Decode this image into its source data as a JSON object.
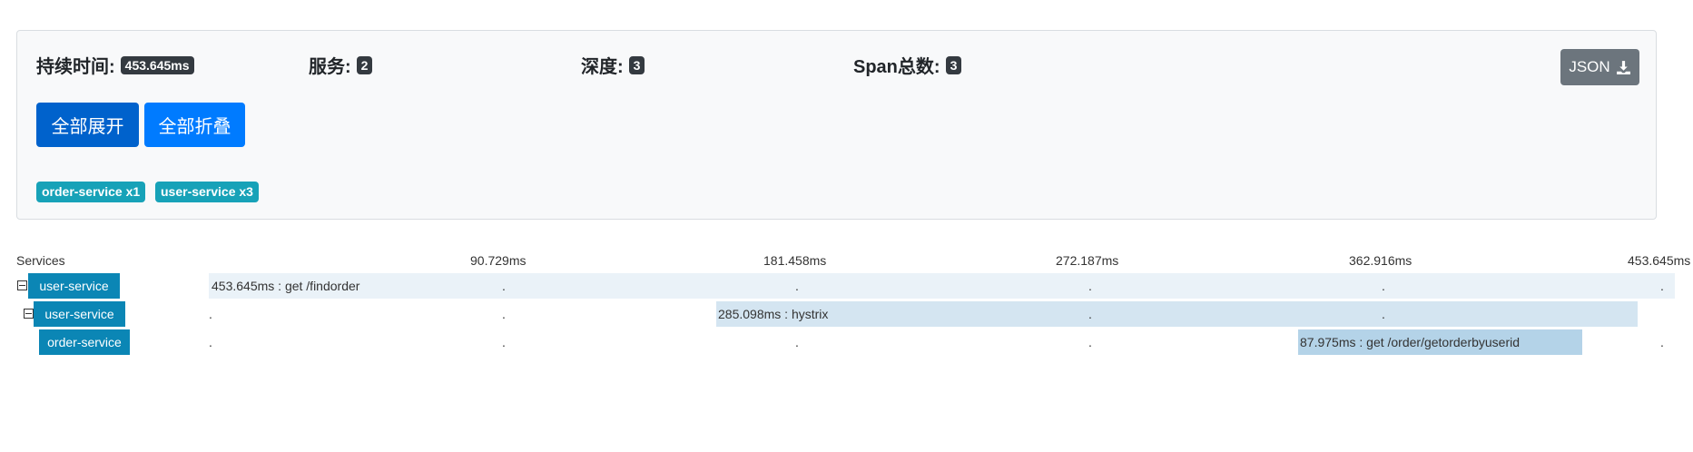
{
  "summary": {
    "duration_label": "持续时间:",
    "duration_value": "453.645ms",
    "services_label": "服务:",
    "services_value": "2",
    "depth_label": "深度:",
    "depth_value": "3",
    "span_total_label": "Span总数:",
    "span_total_value": "3",
    "json_button": "JSON",
    "json_icon": "download-icon"
  },
  "actions": {
    "expand_all": "全部展开",
    "collapse_all": "全部折叠"
  },
  "service_badges": [
    "order-service x1",
    "user-service x3"
  ],
  "timeline": {
    "services_header": "Services",
    "ticks": [
      "90.729ms",
      "181.458ms",
      "272.187ms",
      "362.916ms",
      "453.645ms"
    ],
    "rows": [
      {
        "service": "user-service",
        "span_text": "453.645ms : get /findorder",
        "collapse_icon": "minus-square-icon"
      },
      {
        "service": "user-service",
        "span_text": "285.098ms : hystrix",
        "collapse_icon": "minus-square-icon"
      },
      {
        "service": "order-service",
        "span_text": "87.975ms : get /order/getorderbyuserid"
      }
    ],
    "tick_mark": "."
  },
  "colors": {
    "badge_dark": "#343a40",
    "primary": "#007bff",
    "primary_active": "#0062cc",
    "info": "#17a2b8",
    "secondary": "#6c757d",
    "service_label": "#0b86b5"
  }
}
